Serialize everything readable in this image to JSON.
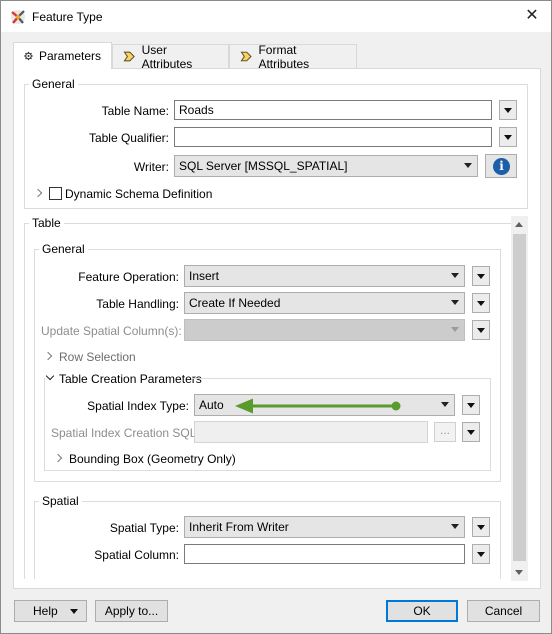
{
  "window": {
    "title": "Feature Type",
    "close_glyph": "✕"
  },
  "tabs": [
    {
      "label": "Parameters",
      "icon": "gear-icon",
      "active": true
    },
    {
      "label": "User Attributes",
      "icon": "arrow-tag-icon",
      "active": false
    },
    {
      "label": "Format Attributes",
      "icon": "arrow-tag-icon",
      "active": false
    }
  ],
  "general": {
    "title": "General",
    "table_name_label": "Table Name:",
    "table_name_value": "Roads",
    "table_qualifier_label": "Table Qualifier:",
    "table_qualifier_value": "",
    "writer_label": "Writer:",
    "writer_value": "SQL Server [MSSQL_SPATIAL]",
    "info_glyph": "i",
    "dynamic_schema_label": "Dynamic Schema Definition"
  },
  "table": {
    "title": "Table",
    "general": {
      "title": "General",
      "feature_operation_label": "Feature Operation:",
      "feature_operation_value": "Insert",
      "table_handling_label": "Table Handling:",
      "table_handling_value": "Create If Needed",
      "update_spatial_label": "Update Spatial Column(s):",
      "update_spatial_value": "",
      "row_selection_label": "Row Selection",
      "creation_params": {
        "title": "Table Creation Parameters",
        "spatial_index_type_label": "Spatial Index Type:",
        "spatial_index_type_value": "Auto",
        "spatial_index_sql_label": "Spatial Index Creation SQL:",
        "spatial_index_sql_value": "",
        "ellipsis": "...",
        "bounding_box_label": "Bounding Box (Geometry Only)"
      }
    },
    "spatial": {
      "title": "Spatial",
      "spatial_type_label": "Spatial Type:",
      "spatial_type_value": "Inherit From Writer",
      "spatial_column_label": "Spatial Column:",
      "spatial_column_value": ""
    }
  },
  "footer": {
    "help_label": "Help",
    "apply_label": "Apply to...",
    "ok_label": "OK",
    "cancel_label": "Cancel"
  },
  "colors": {
    "annotation_arrow": "#5a9b2e",
    "info_icon": "#1b5fa8",
    "default_button_border": "#0078d7"
  }
}
